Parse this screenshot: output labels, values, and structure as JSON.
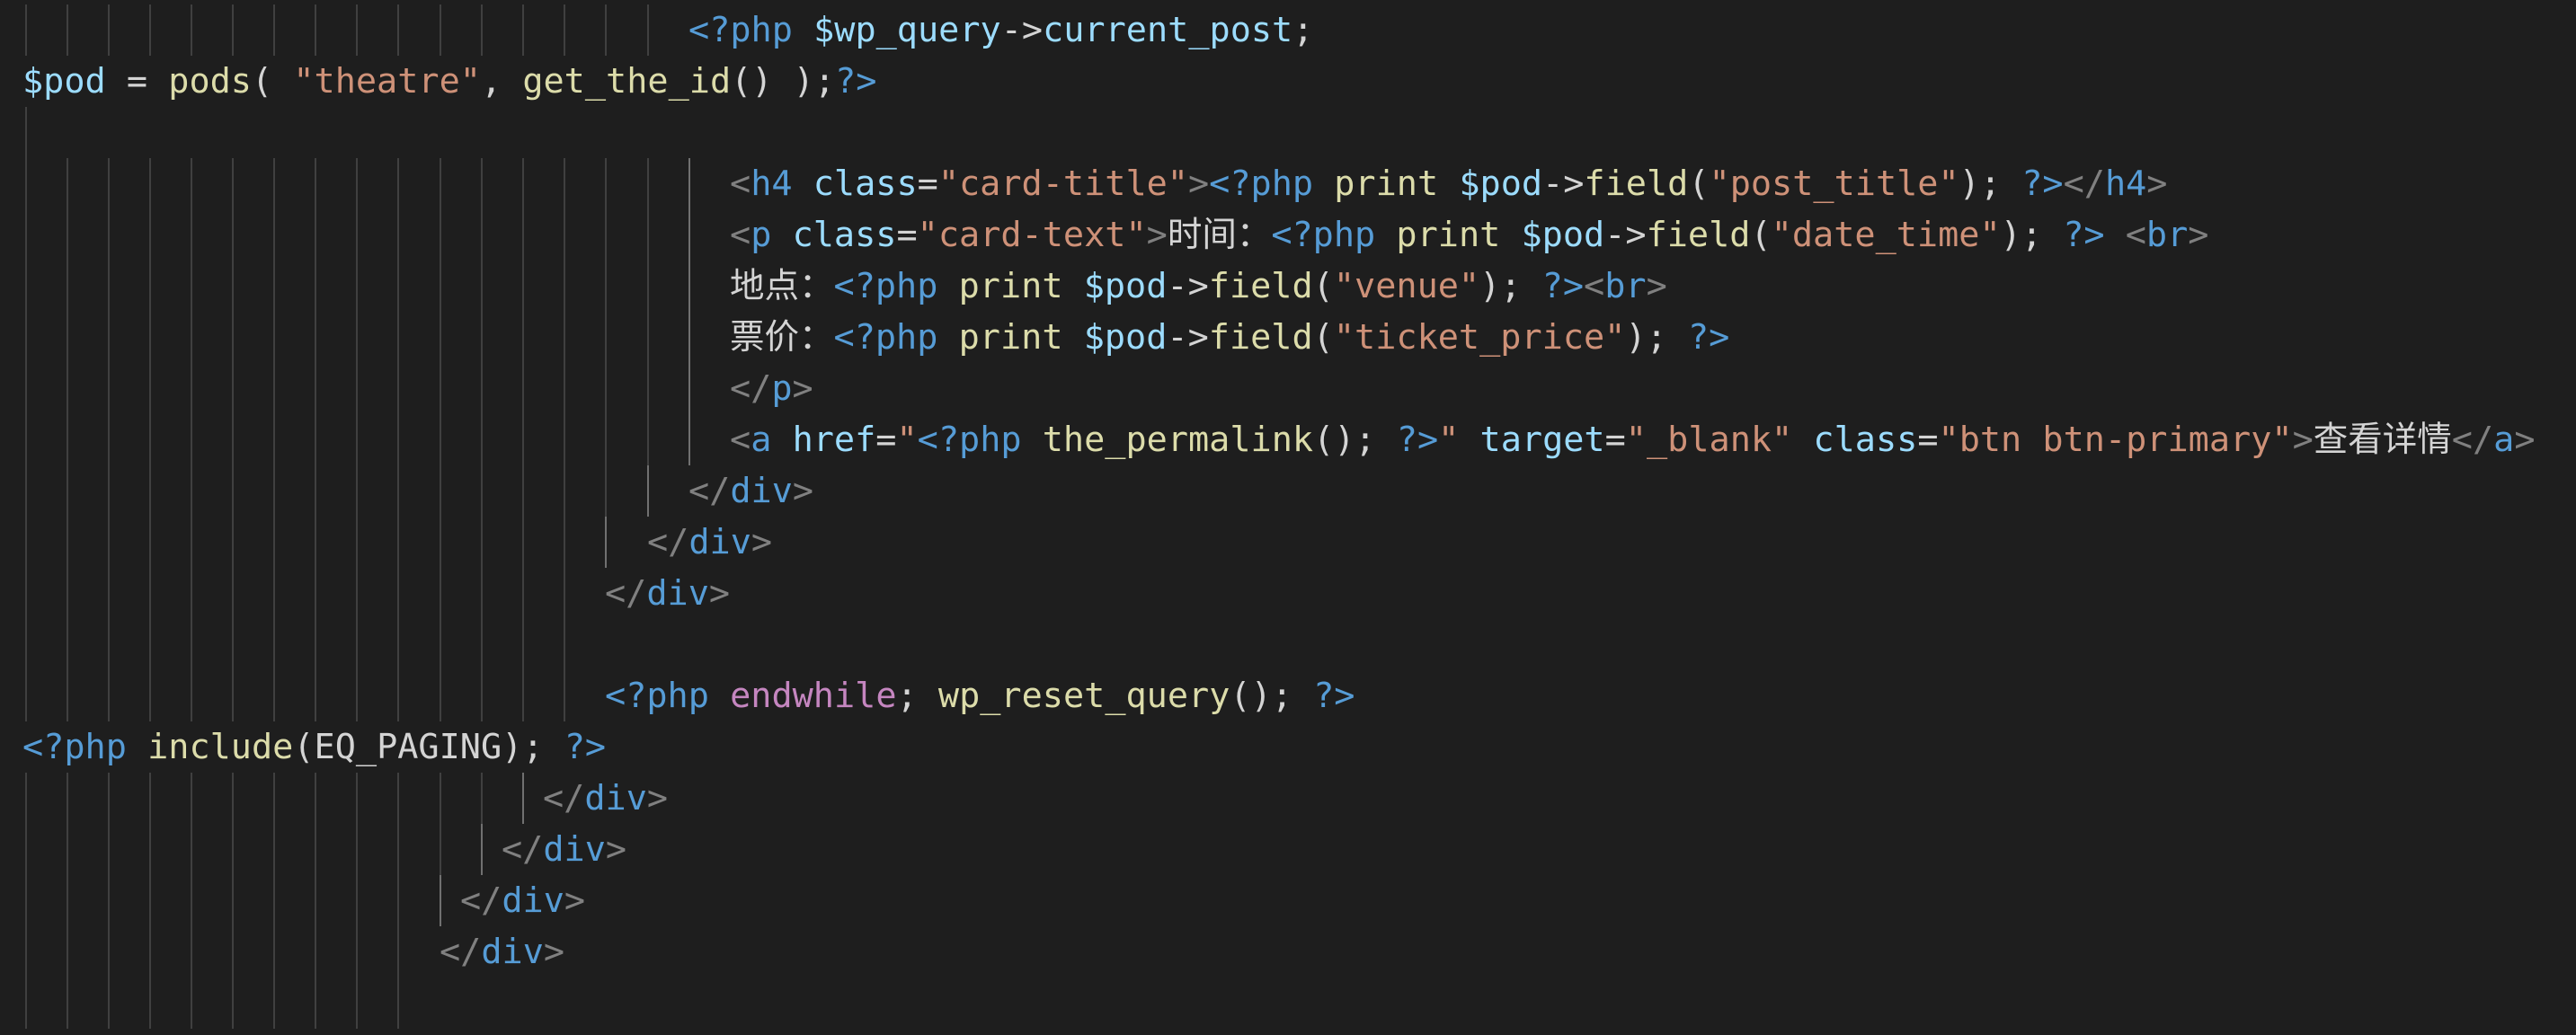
{
  "editor": {
    "colors": {
      "background": "#1e1e1e",
      "text": "#d4d4d4",
      "tag": "#569cd6",
      "punctuation": "#808080",
      "attribute": "#9cdcfe",
      "string": "#ce9178",
      "variable": "#9cdcfe",
      "function": "#dcdcaa",
      "keyword": "#c586c0",
      "indent_guide": "#404040"
    },
    "lines": [
      {
        "tokens": [
          {
            "t": "<?php",
            "k": "tag"
          },
          {
            "t": " ",
            "k": "txt"
          },
          {
            "t": "$wp_query",
            "k": "var"
          },
          {
            "t": "->",
            "k": "txt"
          },
          {
            "t": "current_post",
            "k": "var"
          },
          {
            "t": ";",
            "k": "txt"
          }
        ]
      },
      {
        "tokens": [
          {
            "t": "$pod",
            "k": "var"
          },
          {
            "t": " = ",
            "k": "txt"
          },
          {
            "t": "pods",
            "k": "fn"
          },
          {
            "t": "( ",
            "k": "txt"
          },
          {
            "t": "\"theatre\"",
            "k": "str"
          },
          {
            "t": ", ",
            "k": "txt"
          },
          {
            "t": "get_the_id",
            "k": "fn"
          },
          {
            "t": "() );",
            "k": "txt"
          },
          {
            "t": "?>",
            "k": "tag"
          }
        ]
      },
      {
        "tokens": []
      },
      {
        "tokens": [
          {
            "t": "<",
            "k": "punc"
          },
          {
            "t": "h4",
            "k": "tag"
          },
          {
            "t": " ",
            "k": "txt"
          },
          {
            "t": "class",
            "k": "attr"
          },
          {
            "t": "=",
            "k": "txt"
          },
          {
            "t": "\"card-title\"",
            "k": "str"
          },
          {
            "t": ">",
            "k": "punc"
          },
          {
            "t": "<?php",
            "k": "tag"
          },
          {
            "t": " print ",
            "k": "fn"
          },
          {
            "t": "$pod",
            "k": "var"
          },
          {
            "t": "->",
            "k": "txt"
          },
          {
            "t": "field",
            "k": "fn"
          },
          {
            "t": "(",
            "k": "txt"
          },
          {
            "t": "\"post_title\"",
            "k": "str"
          },
          {
            "t": "); ",
            "k": "txt"
          },
          {
            "t": "?>",
            "k": "tag"
          },
          {
            "t": "</",
            "k": "punc"
          },
          {
            "t": "h4",
            "k": "tag"
          },
          {
            "t": ">",
            "k": "punc"
          }
        ]
      },
      {
        "tokens": [
          {
            "t": "<",
            "k": "punc"
          },
          {
            "t": "p",
            "k": "tag"
          },
          {
            "t": " ",
            "k": "txt"
          },
          {
            "t": "class",
            "k": "attr"
          },
          {
            "t": "=",
            "k": "txt"
          },
          {
            "t": "\"card-text\"",
            "k": "str"
          },
          {
            "t": ">",
            "k": "punc"
          },
          {
            "t": "时间：",
            "k": "cjk"
          },
          {
            "t": "<?php",
            "k": "tag"
          },
          {
            "t": " print ",
            "k": "fn"
          },
          {
            "t": "$pod",
            "k": "var"
          },
          {
            "t": "->",
            "k": "txt"
          },
          {
            "t": "field",
            "k": "fn"
          },
          {
            "t": "(",
            "k": "txt"
          },
          {
            "t": "\"date_time\"",
            "k": "str"
          },
          {
            "t": "); ",
            "k": "txt"
          },
          {
            "t": "?>",
            "k": "tag"
          },
          {
            "t": " ",
            "k": "txt"
          },
          {
            "t": "<",
            "k": "punc"
          },
          {
            "t": "br",
            "k": "tag"
          },
          {
            "t": ">",
            "k": "punc"
          }
        ]
      },
      {
        "tokens": [
          {
            "t": "地点：",
            "k": "cjk"
          },
          {
            "t": "<?php",
            "k": "tag"
          },
          {
            "t": " print ",
            "k": "fn"
          },
          {
            "t": "$pod",
            "k": "var"
          },
          {
            "t": "->",
            "k": "txt"
          },
          {
            "t": "field",
            "k": "fn"
          },
          {
            "t": "(",
            "k": "txt"
          },
          {
            "t": "\"venue\"",
            "k": "str"
          },
          {
            "t": "); ",
            "k": "txt"
          },
          {
            "t": "?>",
            "k": "tag"
          },
          {
            "t": "<",
            "k": "punc"
          },
          {
            "t": "br",
            "k": "tag"
          },
          {
            "t": ">",
            "k": "punc"
          }
        ]
      },
      {
        "tokens": [
          {
            "t": "票价：",
            "k": "cjk"
          },
          {
            "t": "<?php",
            "k": "tag"
          },
          {
            "t": " print ",
            "k": "fn"
          },
          {
            "t": "$pod",
            "k": "var"
          },
          {
            "t": "->",
            "k": "txt"
          },
          {
            "t": "field",
            "k": "fn"
          },
          {
            "t": "(",
            "k": "txt"
          },
          {
            "t": "\"ticket_price\"",
            "k": "str"
          },
          {
            "t": "); ",
            "k": "txt"
          },
          {
            "t": "?>",
            "k": "tag"
          }
        ]
      },
      {
        "tokens": [
          {
            "t": "</",
            "k": "punc"
          },
          {
            "t": "p",
            "k": "tag"
          },
          {
            "t": ">",
            "k": "punc"
          }
        ]
      },
      {
        "tokens": [
          {
            "t": "<",
            "k": "punc"
          },
          {
            "t": "a",
            "k": "tag"
          },
          {
            "t": " ",
            "k": "txt"
          },
          {
            "t": "href",
            "k": "attr"
          },
          {
            "t": "=",
            "k": "txt"
          },
          {
            "t": "\"",
            "k": "str"
          },
          {
            "t": "<?php",
            "k": "tag"
          },
          {
            "t": " ",
            "k": "txt"
          },
          {
            "t": "the_permalink",
            "k": "fn"
          },
          {
            "t": "(); ",
            "k": "txt"
          },
          {
            "t": "?>",
            "k": "tag"
          },
          {
            "t": "\"",
            "k": "str"
          },
          {
            "t": " ",
            "k": "txt"
          },
          {
            "t": "target",
            "k": "attr"
          },
          {
            "t": "=",
            "k": "txt"
          },
          {
            "t": "\"_blank\"",
            "k": "str"
          },
          {
            "t": " ",
            "k": "txt"
          },
          {
            "t": "class",
            "k": "attr"
          },
          {
            "t": "=",
            "k": "txt"
          },
          {
            "t": "\"btn btn-primary\"",
            "k": "str"
          },
          {
            "t": ">",
            "k": "punc"
          },
          {
            "t": "查看详情",
            "k": "cjk"
          },
          {
            "t": "</",
            "k": "punc"
          },
          {
            "t": "a",
            "k": "tag"
          },
          {
            "t": ">",
            "k": "punc"
          }
        ]
      },
      {
        "tokens": [
          {
            "t": "</",
            "k": "punc"
          },
          {
            "t": "div",
            "k": "tag"
          },
          {
            "t": ">",
            "k": "punc"
          }
        ]
      },
      {
        "tokens": [
          {
            "t": "</",
            "k": "punc"
          },
          {
            "t": "div",
            "k": "tag"
          },
          {
            "t": ">",
            "k": "punc"
          }
        ]
      },
      {
        "tokens": [
          {
            "t": "</",
            "k": "punc"
          },
          {
            "t": "div",
            "k": "tag"
          },
          {
            "t": ">",
            "k": "punc"
          }
        ]
      },
      {
        "tokens": []
      },
      {
        "tokens": [
          {
            "t": "<?php",
            "k": "tag"
          },
          {
            "t": " ",
            "k": "txt"
          },
          {
            "t": "endwhile",
            "k": "kw"
          },
          {
            "t": "; ",
            "k": "txt"
          },
          {
            "t": "wp_reset_query",
            "k": "fn"
          },
          {
            "t": "(); ",
            "k": "txt"
          },
          {
            "t": "?>",
            "k": "tag"
          }
        ]
      },
      {
        "tokens": [
          {
            "t": "<?php",
            "k": "tag"
          },
          {
            "t": " ",
            "k": "txt"
          },
          {
            "t": "include",
            "k": "fn"
          },
          {
            "t": "(EQ_PAGING); ",
            "k": "txt"
          },
          {
            "t": "?>",
            "k": "tag"
          }
        ]
      },
      {
        "tokens": [
          {
            "t": "</",
            "k": "punc"
          },
          {
            "t": "div",
            "k": "tag"
          },
          {
            "t": ">",
            "k": "punc"
          }
        ]
      },
      {
        "tokens": [
          {
            "t": "</",
            "k": "punc"
          },
          {
            "t": "div",
            "k": "tag"
          },
          {
            "t": ">",
            "k": "punc"
          }
        ]
      },
      {
        "tokens": [
          {
            "t": "</",
            "k": "punc"
          },
          {
            "t": "div",
            "k": "tag"
          },
          {
            "t": ">",
            "k": "punc"
          }
        ]
      },
      {
        "tokens": [
          {
            "t": "</",
            "k": "punc"
          },
          {
            "t": "div",
            "k": "tag"
          },
          {
            "t": ">",
            "k": "punc"
          }
        ]
      },
      {
        "tokens": []
      }
    ]
  }
}
